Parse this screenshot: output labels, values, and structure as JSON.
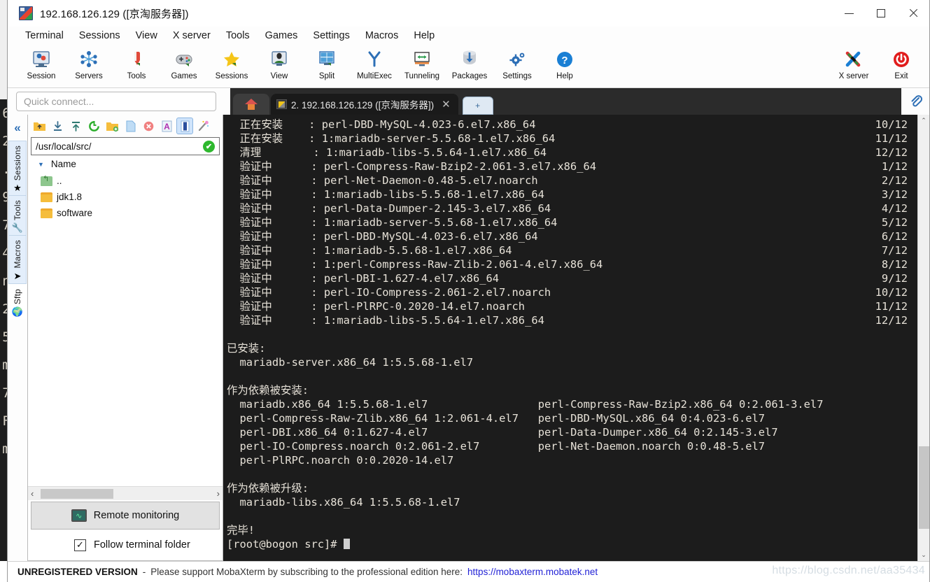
{
  "window": {
    "title": "192.168.126.129 ([京淘服务器])",
    "icon": "mobaxterm-icon",
    "minimize": "—",
    "maximize": "□",
    "close": "✕"
  },
  "menubar": {
    "items": [
      {
        "label": "Terminal"
      },
      {
        "label": "Sessions"
      },
      {
        "label": "View"
      },
      {
        "label": "X server"
      },
      {
        "label": "Tools"
      },
      {
        "label": "Games"
      },
      {
        "label": "Settings"
      },
      {
        "label": "Macros"
      },
      {
        "label": "Help"
      }
    ]
  },
  "toolbar": {
    "buttons": [
      {
        "label": "Session",
        "icon": "session-icon"
      },
      {
        "label": "Servers",
        "icon": "servers-icon"
      },
      {
        "label": "Tools",
        "icon": "tools-icon"
      },
      {
        "label": "Games",
        "icon": "games-icon"
      },
      {
        "label": "Sessions",
        "icon": "sessions-star-icon"
      },
      {
        "label": "View",
        "icon": "view-icon"
      },
      {
        "label": "Split",
        "icon": "split-icon"
      },
      {
        "label": "MultiExec",
        "icon": "multiexec-icon"
      },
      {
        "label": "Tunneling",
        "icon": "tunneling-icon"
      },
      {
        "label": "Packages",
        "icon": "packages-icon"
      },
      {
        "label": "Settings",
        "icon": "settings-gear-icon"
      },
      {
        "label": "Help",
        "icon": "help-icon"
      }
    ],
    "right_buttons": [
      {
        "label": "X server",
        "icon": "xserver-icon"
      },
      {
        "label": "Exit",
        "icon": "exit-power-icon"
      }
    ]
  },
  "quick_connect": {
    "placeholder": "Quick connect..."
  },
  "tabs": {
    "home_icon": "home-icon",
    "active": {
      "label": "2.  192.168.126.129  ([京淘服务器])",
      "close": "✕",
      "icon": "ssh-session-icon"
    },
    "new_tab": "+",
    "clip_icon": "paperclip-icon"
  },
  "rail": {
    "collapse_icon": "«",
    "tabs": [
      {
        "label": "Sessions",
        "icon": "★",
        "selected": false
      },
      {
        "label": "Tools",
        "icon": "🔧",
        "selected": false
      },
      {
        "label": "Macros",
        "icon": "➤",
        "selected": false
      },
      {
        "label": "Sftp",
        "icon": "🌍",
        "selected": true
      }
    ]
  },
  "sftp": {
    "tool_icons": [
      {
        "name": "parent-folder-icon"
      },
      {
        "name": "download-icon"
      },
      {
        "name": "upload-icon"
      },
      {
        "name": "refresh-icon"
      },
      {
        "name": "new-folder-icon"
      },
      {
        "name": "new-file-icon"
      },
      {
        "name": "delete-icon"
      },
      {
        "name": "text-editor-icon"
      },
      {
        "name": "toggle-panel-icon"
      },
      {
        "name": "magic-wand-icon"
      }
    ],
    "path": "/usr/local/src/",
    "path_ok": "✔",
    "column_header": "Name",
    "files": [
      {
        "name": "..",
        "type": "up"
      },
      {
        "name": "jdk1.8",
        "type": "dir"
      },
      {
        "name": "software",
        "type": "dir"
      }
    ],
    "hscroll_left": "‹",
    "hscroll_right": "›",
    "remote_monitoring": "Remote monitoring",
    "remote_monitoring_icon": "monitor-graph-icon",
    "follow_terminal_folder": "Follow terminal folder",
    "follow_checked": "✓"
  },
  "terminal": {
    "lines": [
      {
        "text": "  正在安装    : perl-DBD-MySQL-4.023-6.el7.x86_64",
        "count": "10/12"
      },
      {
        "text": "  正在安装    : 1:mariadb-server-5.5.68-1.el7.x86_64",
        "count": "11/12"
      },
      {
        "text": "  清理        : 1:mariadb-libs-5.5.64-1.el7.x86_64",
        "count": "12/12"
      },
      {
        "text": "  验证中      : perl-Compress-Raw-Bzip2-2.061-3.el7.x86_64",
        "count": "1/12"
      },
      {
        "text": "  验证中      : perl-Net-Daemon-0.48-5.el7.noarch",
        "count": "2/12"
      },
      {
        "text": "  验证中      : 1:mariadb-libs-5.5.68-1.el7.x86_64",
        "count": "3/12"
      },
      {
        "text": "  验证中      : perl-Data-Dumper-2.145-3.el7.x86_64",
        "count": "4/12"
      },
      {
        "text": "  验证中      : 1:mariadb-server-5.5.68-1.el7.x86_64",
        "count": "5/12"
      },
      {
        "text": "  验证中      : perl-DBD-MySQL-4.023-6.el7.x86_64",
        "count": "6/12"
      },
      {
        "text": "  验证中      : 1:mariadb-5.5.68-1.el7.x86_64",
        "count": "7/12"
      },
      {
        "text": "  验证中      : 1:perl-Compress-Raw-Zlib-2.061-4.el7.x86_64",
        "count": "8/12"
      },
      {
        "text": "  验证中      : perl-DBI-1.627-4.el7.x86_64",
        "count": "9/12"
      },
      {
        "text": "  验证中      : perl-IO-Compress-2.061-2.el7.noarch",
        "count": "10/12"
      },
      {
        "text": "  验证中      : perl-PlRPC-0.2020-14.el7.noarch",
        "count": "11/12"
      },
      {
        "text": "  验证中      : 1:mariadb-libs-5.5.64-1.el7.x86_64",
        "count": "12/12"
      },
      {
        "text": "",
        "count": ""
      },
      {
        "text": "已安装:",
        "count": ""
      },
      {
        "text": "  mariadb-server.x86_64 1:5.5.68-1.el7",
        "count": ""
      },
      {
        "text": "",
        "count": ""
      },
      {
        "text": "作为依赖被安装:",
        "count": ""
      },
      {
        "text": "  mariadb.x86_64 1:5.5.68-1.el7                 perl-Compress-Raw-Bzip2.x86_64 0:2.061-3.el7",
        "count": ""
      },
      {
        "text": "  perl-Compress-Raw-Zlib.x86_64 1:2.061-4.el7   perl-DBD-MySQL.x86_64 0:4.023-6.el7",
        "count": ""
      },
      {
        "text": "  perl-DBI.x86_64 0:1.627-4.el7                 perl-Data-Dumper.x86_64 0:2.145-3.el7",
        "count": ""
      },
      {
        "text": "  perl-IO-Compress.noarch 0:2.061-2.el7         perl-Net-Daemon.noarch 0:0.48-5.el7",
        "count": ""
      },
      {
        "text": "  perl-PlRPC.noarch 0:0.2020-14.el7",
        "count": ""
      },
      {
        "text": "",
        "count": ""
      },
      {
        "text": "作为依赖被升级:",
        "count": ""
      },
      {
        "text": "  mariadb-libs.x86_64 1:5.5.68-1.el7",
        "count": ""
      },
      {
        "text": "",
        "count": ""
      },
      {
        "text": "完毕!",
        "count": ""
      }
    ],
    "prompt": "[root@bogon src]# "
  },
  "background_window": {
    "text": "6\n2\n.\n9\n7\n4\nn\n2\n5\nm\n7\nF\nm"
  },
  "scrollbar": {
    "up": "⌃",
    "down": "⌄"
  },
  "status": {
    "badge": "UNREGISTERED VERSION",
    "dash": "-",
    "text": "Please support MobaXterm by subscribing to the professional edition here:",
    "link": "https://mobaxterm.mobatek.net",
    "watermark": "https://blog.csdn.net/aa35434"
  },
  "colors": {
    "accent": "#2d6fb6",
    "terminal_bg": "#1c1c1c",
    "terminal_fg": "#e6e1d7",
    "link": "#2323d6",
    "tab_bg": "#2b2b2b"
  }
}
